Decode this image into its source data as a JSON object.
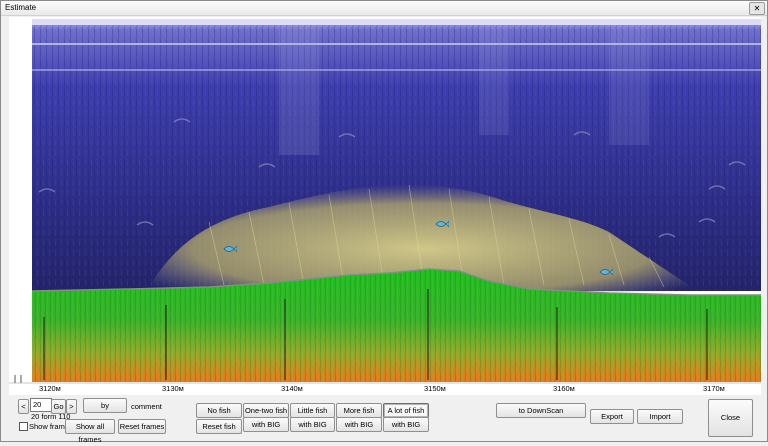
{
  "window": {
    "title": "Estimate",
    "close_glyph": "✕"
  },
  "ruler": {
    "ticks": [
      "3120м",
      "3130м",
      "3140м",
      "3150м",
      "3160м",
      "3170м"
    ]
  },
  "nav": {
    "prev_label": "<",
    "frame_value": "20",
    "go_label": "Go",
    "next_label": ">",
    "by_label": "by",
    "frame_from": "20 form 110",
    "comment_label": "comment",
    "show_frame_label": "Show frame",
    "show_all_frames_label": "Show all frames",
    "reset_frames_label": "Reset frames"
  },
  "fish_buttons": {
    "no_fish": "No fish",
    "one_two_fish": "One-two fish",
    "little_fish": "Little fish",
    "more_fish": "More fish",
    "a_lot_of_fish": "A lot of fish",
    "reset_fish": "Reset fish",
    "with_big": "with BIG"
  },
  "actions": {
    "to_downscan": "to DownScan",
    "export": "Export",
    "import": "Import",
    "close": "Close"
  },
  "colors": {
    "water_top": "#3a3aa8",
    "water_deep": "#2b2b80",
    "bottom_green": "#22c022",
    "bottom_orange": "#e87818",
    "fish_school": "#c8c07a"
  }
}
